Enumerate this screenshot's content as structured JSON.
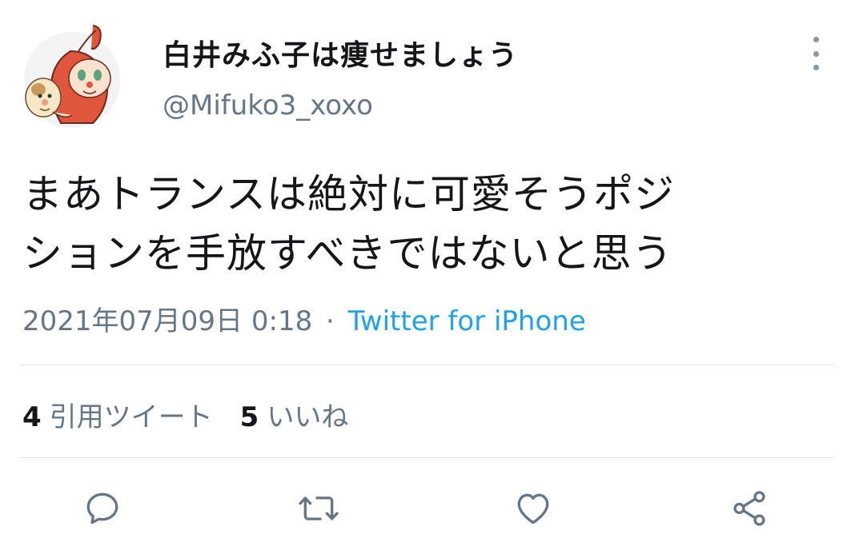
{
  "user": {
    "display_name": "白井みふ子は痩せましょう",
    "handle": "@Mifuko3_xoxo",
    "avatar_icon": "avatar-dokin-chan"
  },
  "tweet": {
    "text_line1": "まあトランスは絶対に可愛そうポジ",
    "text_line2": "ションを手放すべきではないと思う",
    "timestamp": "2021年07月09日 0:18",
    "separator": "·",
    "source": "Twitter for iPhone"
  },
  "stats": {
    "quote_count": "4",
    "quote_label": "引用ツイート",
    "like_count": "5",
    "like_label": "いいね"
  },
  "actions": {
    "reply_icon": "reply-icon",
    "retweet_icon": "retweet-icon",
    "like_icon": "heart-icon",
    "share_icon": "share-icon"
  },
  "colors": {
    "text_primary": "#14171a",
    "text_secondary": "#657786",
    "accent": "#1da1f2",
    "divider": "#e1e8ed",
    "icon": "#657786"
  }
}
